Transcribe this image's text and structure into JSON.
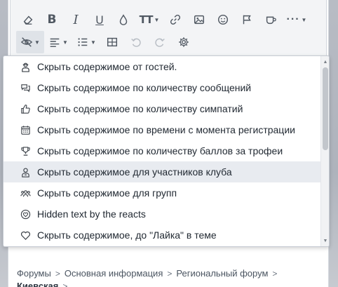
{
  "dropdown": {
    "items": [
      {
        "label": "Скрыть содержимое от гостей.",
        "icon": "user-secret-icon"
      },
      {
        "label": "Скрыть содержимое по количеству сообщений",
        "icon": "comments-icon"
      },
      {
        "label": "Скрыть содержимое по количеству симпатий",
        "icon": "thumbs-up-icon"
      },
      {
        "label": "Скрыть содержимое по времени с момента регистрации",
        "icon": "calendar-icon"
      },
      {
        "label": "Скрыть содержимое по количеству баллов за трофеи",
        "icon": "trophy-icon"
      },
      {
        "label": "Скрыть содержимое для участников клуба",
        "icon": "user-badge-icon"
      },
      {
        "label": "Скрыть содержимое для групп",
        "icon": "users-icon"
      },
      {
        "label": "Hidden text by the reacts",
        "icon": "heart-circle-icon"
      },
      {
        "label": "Скрыть содержимое, до \"Лайка\" в теме",
        "icon": "heart-icon"
      }
    ],
    "hovered_index": 5
  },
  "breadcrumb": {
    "items": [
      "Форумы",
      "Основная информация",
      "Региональный форум"
    ],
    "last": "Киевская"
  },
  "colors": {
    "toolbar_bg": "#f3f4f6",
    "hover_bg": "#e8ebf0",
    "icon": "#505862",
    "text": "#222a33"
  }
}
